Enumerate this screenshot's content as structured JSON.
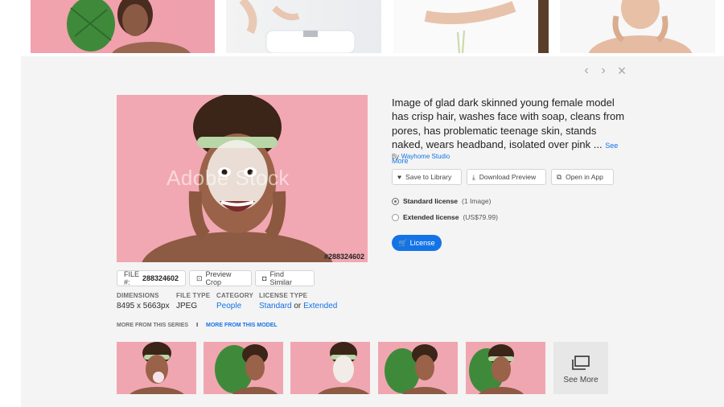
{
  "top_strip": {
    "thumbnails": [
      "woman-with-palm-leaf",
      "hands-at-sink",
      "hands-with-water",
      "woman-touching-face"
    ]
  },
  "detail": {
    "nav": {
      "prev_icon": "‹",
      "next_icon": "›",
      "close_icon": "×"
    },
    "image": {
      "watermark": "Adobe Stock",
      "file_number_overlay": "#288324602"
    },
    "title": "Image of glad dark skinned young female model has crisp hair, washes face with soap, cleans from pores, has problematic teenage skin, stands naked, wears headband, isolated over pink ...",
    "see_more": "See More",
    "byline_prefix": "By",
    "author": "Wayhome Studio",
    "actions": {
      "save": "Save to Library",
      "download": "Download Preview",
      "open": "Open in App"
    },
    "licenses": {
      "standard_label": "Standard license",
      "standard_note": "(1 Image)",
      "extended_label": "Extended license",
      "extended_note": "(US$79.99)"
    },
    "license_button": "License",
    "file": {
      "label": "FILE #:",
      "number": "288324602",
      "preview_crop": "Preview Crop",
      "find_similar": "Find Similar"
    },
    "meta": {
      "dimensions_label": "DIMENSIONS",
      "dimensions_value": "8495 x 5663px",
      "file_type_label": "FILE TYPE",
      "file_type_value": "JPEG",
      "category_label": "CATEGORY",
      "category_value": "People",
      "license_type_label": "LICENSE TYPE",
      "license_standard": "Standard",
      "license_or": "or",
      "license_extended": "Extended"
    },
    "series_tabs": {
      "series": "MORE FROM THIS SERIES",
      "divider": "I",
      "model": "MORE FROM THIS MODEL"
    },
    "see_more_tile": "See More"
  },
  "colors": {
    "accent": "#1473e6",
    "panel_bg": "#f4f4f4",
    "image_pink": "#f0a6b1"
  }
}
